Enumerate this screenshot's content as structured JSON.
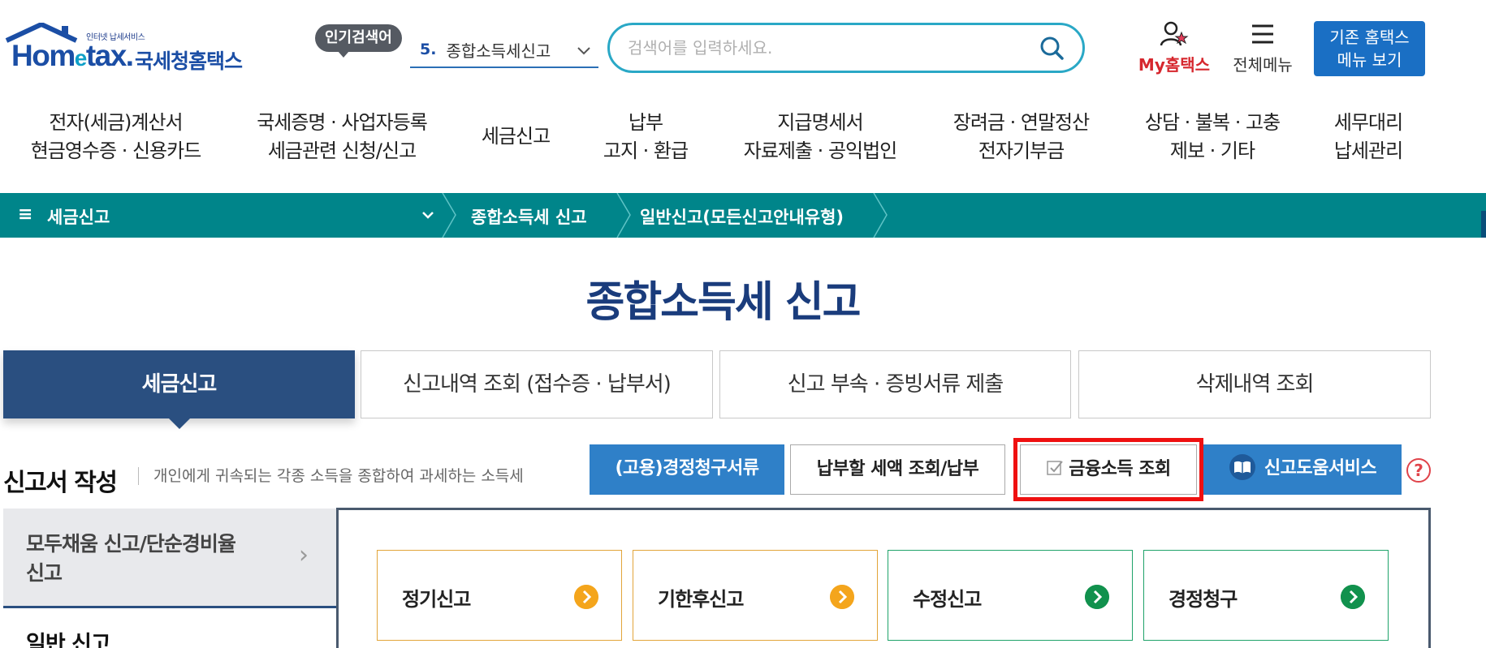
{
  "header": {
    "logo_sub": "인터넷 납세서비스",
    "logo_brand_a": "Hom",
    "logo_brand_e": "e",
    "logo_brand_b": "tax.",
    "logo_brand_kr": "국세청홈택스",
    "popular_badge": "인기검색어",
    "popular_rank": "5.",
    "popular_keyword": "종합소득세신고",
    "search_placeholder": "검색어를 입력하세요.",
    "my_hometax": "My홈택스",
    "all_menu": "전체메뉴",
    "old_home_line1": "기존 홈택스",
    "old_home_line2": "메뉴 보기"
  },
  "gnb": [
    {
      "l1": "전자(세금)계산서",
      "l2": "현금영수증 · 신용카드"
    },
    {
      "l1": "국세증명 · 사업자등록",
      "l2": "세금관련 신청/신고"
    },
    {
      "l1": "세금신고",
      "l2": ""
    },
    {
      "l1": "납부",
      "l2": "고지 · 환급"
    },
    {
      "l1": "지급명세서",
      "l2": "자료제출 · 공익법인"
    },
    {
      "l1": "장려금 · 연말정산",
      "l2": "전자기부금"
    },
    {
      "l1": "상담 · 불복 · 고충",
      "l2": "제보 · 기타"
    },
    {
      "l1": "세무대리",
      "l2": "납세관리"
    }
  ],
  "breadcrumb": {
    "menu_icon": "≡",
    "c1": "세금신고",
    "c2": "종합소득세 신고",
    "c3": "일반신고(모든신고안내유형)"
  },
  "page_title": "종합소득세 신고",
  "tabs": [
    {
      "label": "세금신고"
    },
    {
      "label": "신고내역 조회 (접수증 · 납부서)"
    },
    {
      "label": "신고 부속 · 증빙서류 제출"
    },
    {
      "label": "삭제내역 조회"
    }
  ],
  "section": {
    "title": "신고서 작성",
    "desc": "개인에게 귀속되는 각종 소득을 종합하여 과세하는 소득세"
  },
  "actions": {
    "claim_docs": "(고용)경정청구서류",
    "pay_tax": "납부할 세액 조회/납부",
    "finance_income": "금융소득 조회",
    "help_service": "신고도움서비스",
    "help_q": "?"
  },
  "left_nav": {
    "item1_l1": "모두채움 신고/단순경비율",
    "item1_l2": "신고",
    "item1_arrow": "›",
    "item2": "일반 신고"
  },
  "cards": [
    {
      "label": "정기신고",
      "color": "#f4a51c"
    },
    {
      "label": "기한후신고",
      "color": "#f4a51c"
    },
    {
      "label": "수정신고",
      "color": "#11914d"
    },
    {
      "label": "경정청구",
      "color": "#11914d"
    }
  ],
  "colors": {
    "brand": "#1b4ea5",
    "breadcrumb_bg": "#00858a",
    "tab_active": "#2a4f80",
    "button_blue": "#2f80c8",
    "highlight": "#ef1010"
  }
}
